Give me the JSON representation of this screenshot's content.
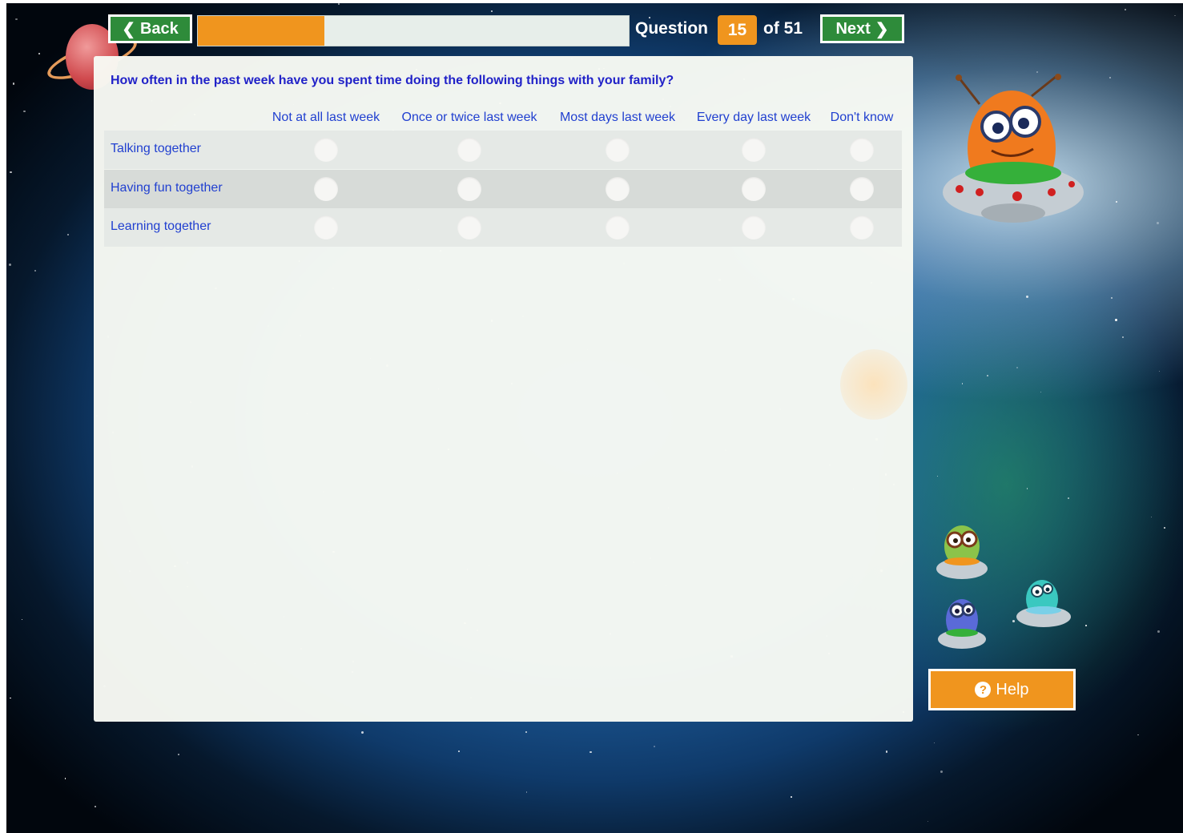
{
  "nav": {
    "back_label": "Back",
    "next_label": "Next",
    "progress_fraction": 0.294,
    "question_label": "Question",
    "question_number": "15",
    "question_total": "of 51"
  },
  "question": {
    "prompt": "How often in the past week have you spent time doing the following things with your family?",
    "columns": [
      "Not at all last week",
      "Once or twice last week",
      "Most days last week",
      "Every day last week",
      "Don't know"
    ],
    "rows": [
      "Talking together",
      "Having fun together",
      "Learning together"
    ]
  },
  "help": {
    "label": "Help",
    "icon": "question-circle-icon"
  },
  "colors": {
    "accent_orange": "#f0951e",
    "nav_green": "#2e8b3a",
    "text_blue": "#2140d0",
    "prompt_blue": "#2122c8"
  }
}
